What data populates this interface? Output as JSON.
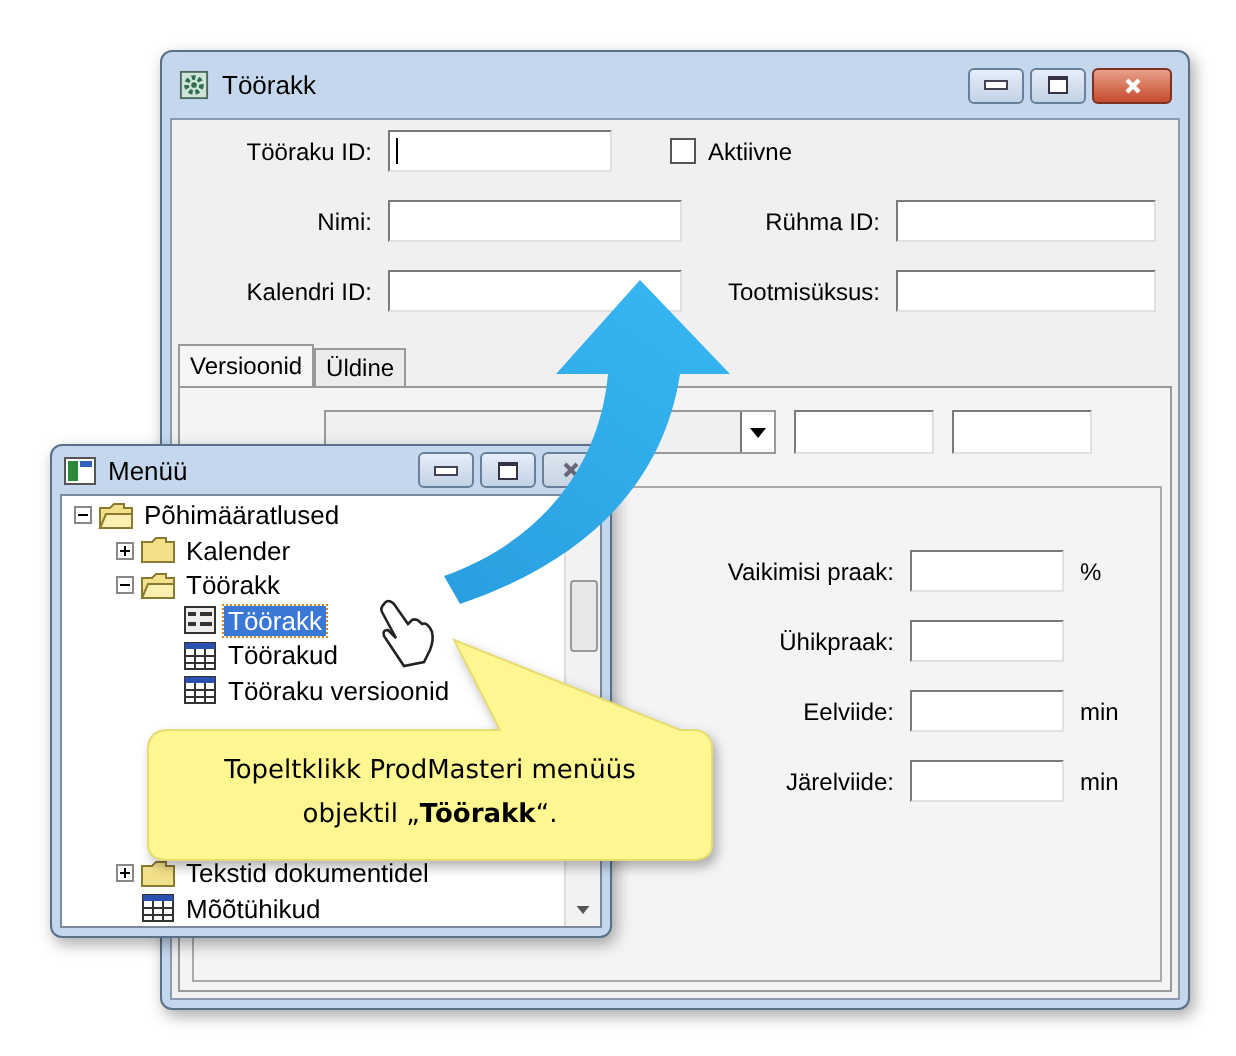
{
  "main_window": {
    "title": "Töörakk",
    "header_fields": [
      {
        "label": "Tööraku ID:"
      },
      {
        "label": "Nimi:"
      },
      {
        "label": "Rühma ID:"
      },
      {
        "label": "Kalendri ID:"
      },
      {
        "label": "Tootmisüksus:"
      }
    ],
    "active_checkbox": {
      "label": "Aktiivne",
      "checked": false
    },
    "tabs": [
      {
        "label": "Versioonid",
        "selected": true
      },
      {
        "label": "Üldine",
        "selected": false
      }
    ],
    "version_fields": [
      {
        "label": "Vaikimisi praak:",
        "unit": "%"
      },
      {
        "label": "Ühikpraak:"
      },
      {
        "label": "Eelviide:",
        "unit": "min"
      },
      {
        "label": "Järelviide:",
        "unit": "min"
      }
    ]
  },
  "menu_window": {
    "title": "Menüü",
    "tree": [
      {
        "label": "Põhimääratlused",
        "kind": "folder",
        "expanded": true,
        "selected": false,
        "children": [
          {
            "label": "Kalender",
            "kind": "folder",
            "expanded": false,
            "selected": false
          },
          {
            "label": "Töörakk",
            "kind": "folder",
            "expanded": true,
            "selected": false,
            "children": [
              {
                "label": "Töörakk",
                "kind": "form",
                "selected": true
              },
              {
                "label": "Töörakud",
                "kind": "table",
                "selected": false
              },
              {
                "label": "Tööraku versioonid",
                "kind": "table",
                "selected": false
              }
            ]
          },
          {
            "label": "Tekstid dokumentidel",
            "kind": "folder",
            "expanded": false,
            "selected": false
          },
          {
            "label": "Mõõtühikud",
            "kind": "table",
            "selected": false
          }
        ]
      }
    ]
  },
  "callout": {
    "text": "Topeltklikk ProdMasteri menüüs objektil „**Töörakk**“."
  }
}
